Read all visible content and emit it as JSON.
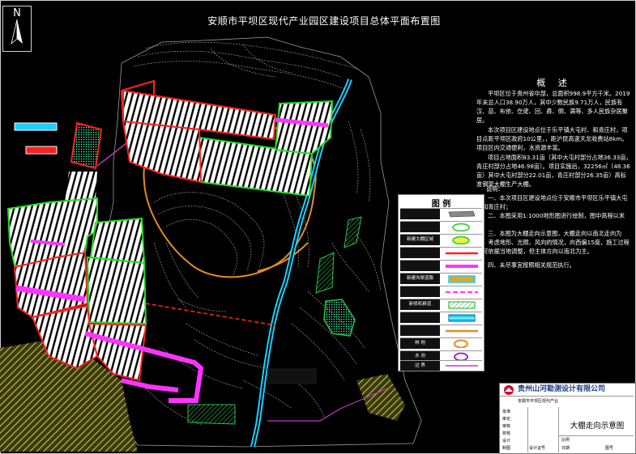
{
  "drawing": {
    "title": "安顺市平坝区现代产业园区建设项目总体平面布置图",
    "north_label": "N"
  },
  "overview": {
    "heading": "概  述",
    "paragraphs": [
      "平坝区位于贵州省中部，总面积998.9平方千米。2019年末总人口38.90万人，其中少数民族9.71万人，民族有汉、苗、布依、仡佬、回、彝、侗、满等、多人民族杂居聚居。",
      "本次项目区建设地点位于乐平镇大屯村、和青庄村，项目点距平坝区政府10公里，，距沪昆高速天龙收费站8km。项目区内交通便利，水资源丰富。",
      "项目占地面积83.31亩（其中大屯村部分占地36.33亩，青庄村部分占地46.98亩）。项目实施后，32256㎡（48.36亩）其中大屯村部分22.01亩，青庄村部分26.35亩）高标准钢架大棚生产大棚。"
    ]
  },
  "notes": {
    "heading": "说明：",
    "items": [
      "一、本次项目区建设地点位于安顺市平坝区乐平镇大屯村和青庄村；",
      "二、本图采用1:1000地形图进行绘制，图中高程以米计；",
      "三、本图为大棚走向示意图，大棚走向以南北走向为主，考虑地形、光照、风向的情况，向西偏15度，施工过程中可依据当地调整，但主体方向以南北为主。",
      "四、未尽事宜按照相关规范执行。"
    ]
  },
  "legend": {
    "title": "图  例",
    "rows": [
      {
        "label": "",
        "symbol": "hatch-gray"
      },
      {
        "label": "",
        "symbol": "green-oval"
      },
      {
        "label": "新建大棚区域",
        "symbol": "green-yellow-oval"
      },
      {
        "label": "",
        "symbol": "red-line"
      },
      {
        "label": "",
        "symbol": "pink-line"
      },
      {
        "label": "新建沟渠道路",
        "symbol": "cyan-double"
      },
      {
        "label": "",
        "symbol": "magenta-dash"
      },
      {
        "label": "新修机耕道",
        "symbol": "green-hatch"
      },
      {
        "label": "",
        "symbol": "cyan-hatch"
      },
      {
        "label": "",
        "symbol": "orange-line"
      },
      {
        "label": "林 地",
        "symbol": "orange-oval"
      },
      {
        "label": "水 池",
        "symbol": "purple-oval"
      },
      {
        "label": "边 界",
        "symbol": "purple-line"
      }
    ]
  },
  "titleblock": {
    "company": "贵州山河勘测设计有限公司",
    "drawing_name": "大棚走向示意图",
    "project": "安顺市平坝区现代产业",
    "cells": [
      "批准",
      "审定",
      "审核",
      "校核",
      "设计",
      "制图",
      "设计证号",
      "比例",
      "日期",
      "图号"
    ]
  },
  "colors": {
    "background": "#000000",
    "greenhouse_outline": "#22dd22",
    "greenhouse_fill": "#ffffff",
    "red_boundary": "#ff2020",
    "road": "#ff33ff",
    "river": "#19d0ff",
    "forest": "#e68a1f",
    "boundary_line": "#c03cc0",
    "farmland": "#c9c34a",
    "contour": "#d0d0d0"
  }
}
